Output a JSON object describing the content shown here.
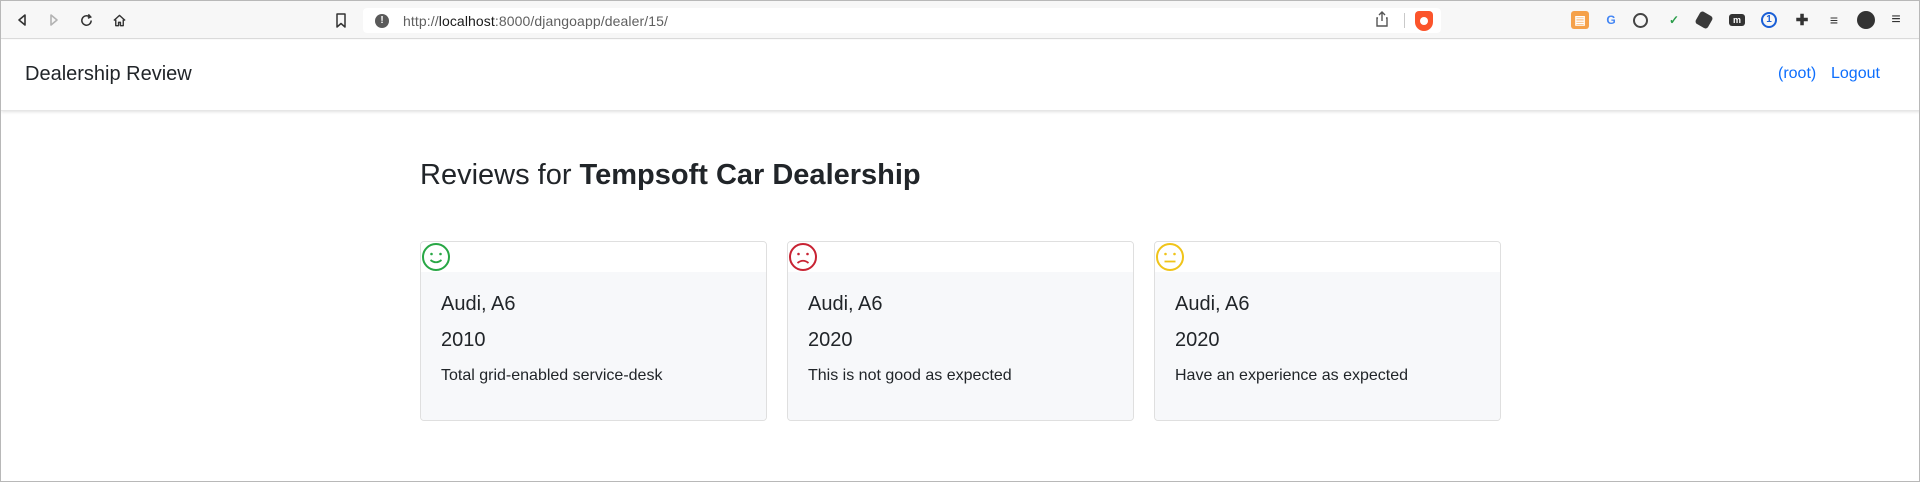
{
  "browser": {
    "url_prefix": "http://",
    "url_host": "localhost",
    "url_path": ":8000/djangoapp/dealer/15/"
  },
  "navbar": {
    "brand": "Dealership Review",
    "user_link": "(root)",
    "logout_link": "Logout"
  },
  "page": {
    "heading_prefix": "Reviews for ",
    "dealer_name": "Tempsoft Car Dealership"
  },
  "reviews": [
    {
      "sentiment": "positive",
      "sentiment_color": "#28a745",
      "car": "Audi, A6",
      "year": "2010",
      "review": "Total grid-enabled service-desk"
    },
    {
      "sentiment": "negative",
      "sentiment_color": "#c82333",
      "car": "Audi, A6",
      "year": "2020",
      "review": "This is not good as expected"
    },
    {
      "sentiment": "neutral",
      "sentiment_color": "#f0c419",
      "car": "Audi, A6",
      "year": "2020",
      "review": "Have an experience as expected"
    }
  ]
}
